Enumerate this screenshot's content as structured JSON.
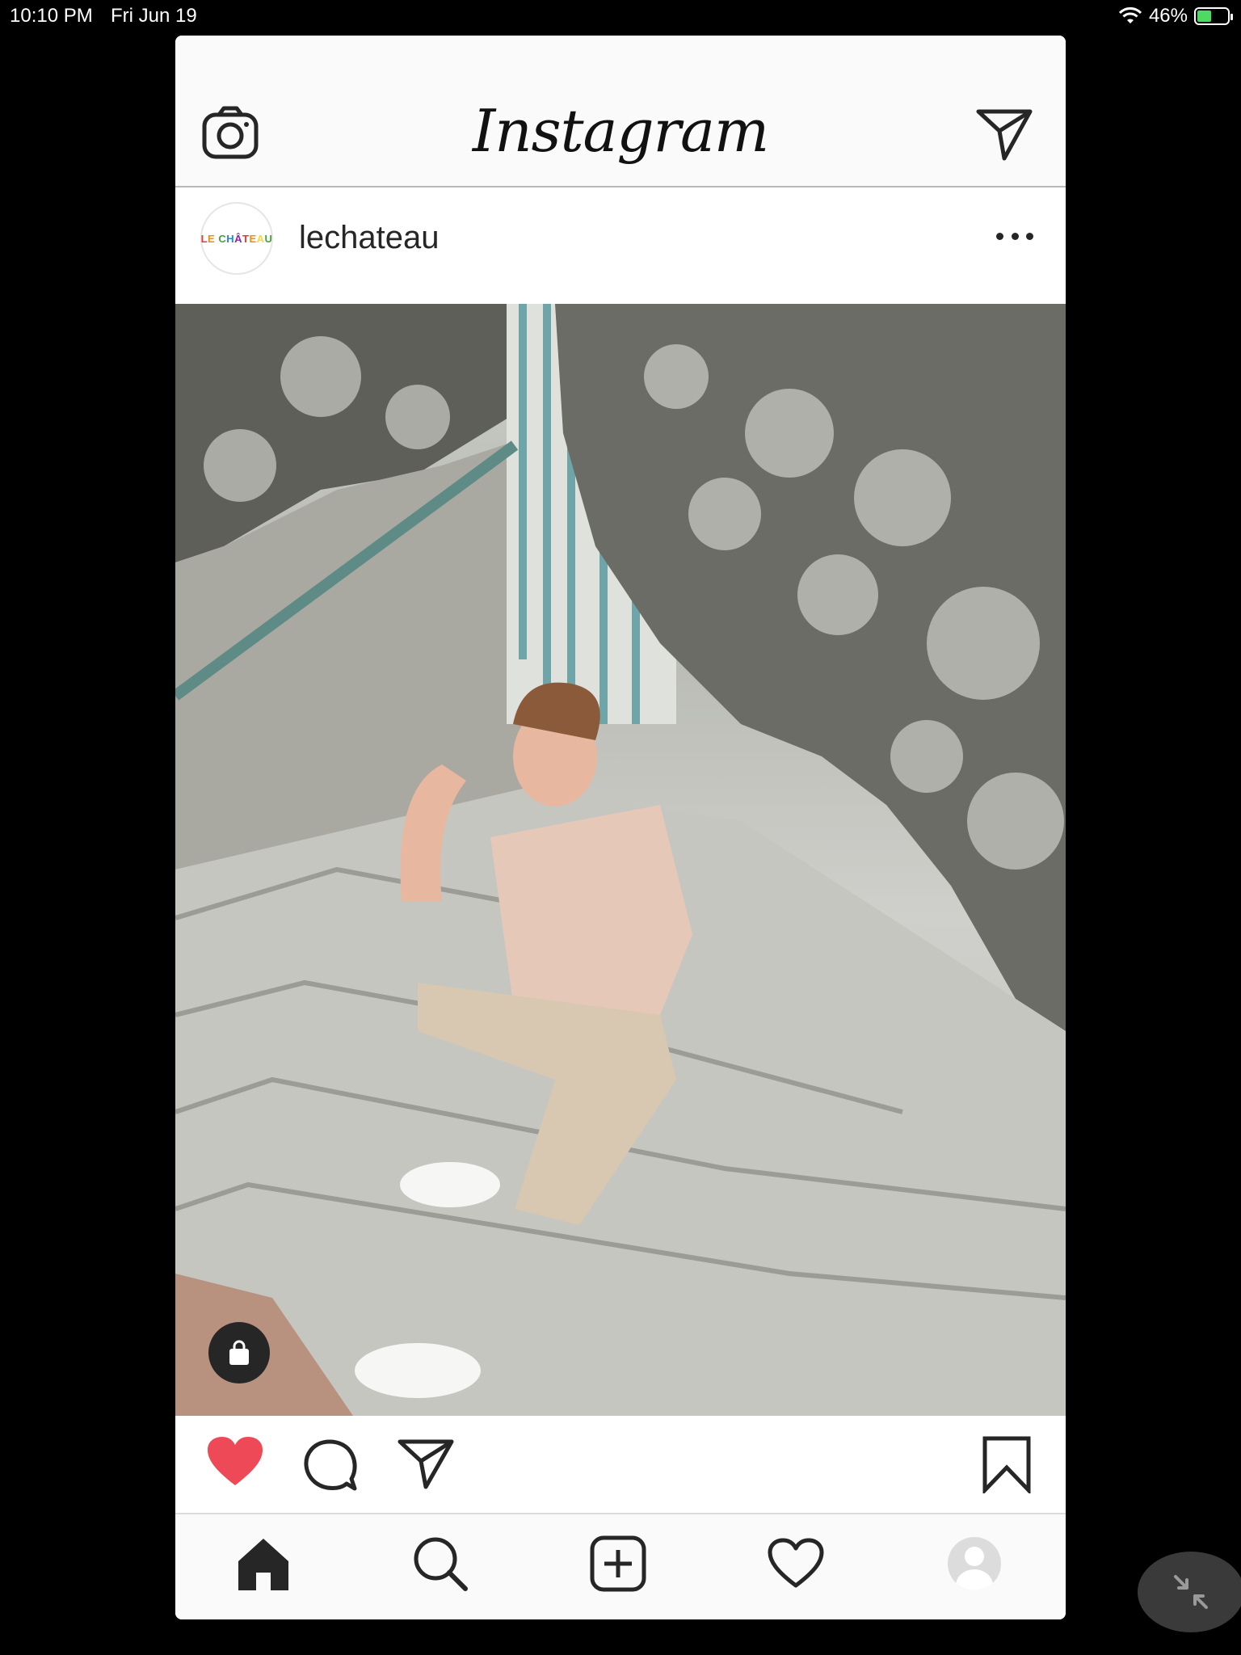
{
  "status_bar": {
    "time": "10:10 PM",
    "date": "Fri Jun 19",
    "battery_percent": "46%",
    "battery_level": 0.46,
    "charging": true
  },
  "app": {
    "logo_text": "Instagram",
    "icons": {
      "camera": "camera-icon",
      "direct": "paper-plane-icon"
    }
  },
  "post": {
    "username": "lechateau",
    "avatar_text": "LE CHÂTEAU",
    "avatar_colors": [
      "#e53935",
      "#fb8c00",
      "#fdd835",
      "#43a047",
      "#1e88e5",
      "#8e24aa"
    ],
    "liked": true,
    "like_color": "#ed4956",
    "photo_description_icon": "photo"
  },
  "tabs": [
    {
      "name": "home",
      "icon": "home-icon",
      "active": true
    },
    {
      "name": "search",
      "icon": "search-icon"
    },
    {
      "name": "new-post",
      "icon": "plus-square-icon"
    },
    {
      "name": "activity",
      "icon": "heart-icon"
    },
    {
      "name": "profile",
      "icon": "profile-avatar"
    }
  ]
}
